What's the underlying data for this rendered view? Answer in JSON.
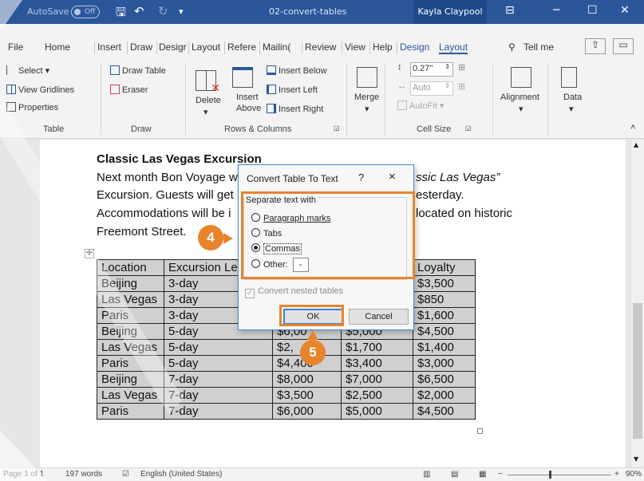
{
  "titlebar": {
    "autosave": "AutoSave",
    "autosave_state": "Off",
    "doc_title": "02-convert-tables",
    "user": "Kayla Claypool"
  },
  "tabs": [
    "File",
    "Home",
    "Insert",
    "Draw",
    "Design",
    "Layout",
    "References",
    "Mailings",
    "Review",
    "View",
    "Help",
    "Design",
    "Layout"
  ],
  "tabs_display": [
    "File",
    "Home",
    "Insert",
    "Draw",
    "Desigr",
    "Layout",
    "Refere",
    "Mailin(",
    "Review",
    "View",
    "Help",
    "Design",
    "Layout"
  ],
  "tell_me": "Tell me",
  "ribbon": {
    "select": "Select",
    "view_gridlines": "View Gridlines",
    "properties": "Properties",
    "draw_table": "Draw Table",
    "eraser": "Eraser",
    "delete": "Delete",
    "insert_above": "Insert Above",
    "insert_above_1": "Insert",
    "insert_above_2": "Above",
    "insert_below": "Insert Below",
    "insert_left": "Insert Left",
    "insert_right": "Insert Right",
    "merge": "Merge",
    "height": "0.27\"",
    "width": "Auto",
    "autofit": "AutoFit",
    "alignment": "Alignment",
    "data": "Data",
    "groups": {
      "table": "Table",
      "draw": "Draw",
      "rows_columns": "Rows & Columns",
      "cell_size": "Cell Size"
    }
  },
  "document": {
    "heading": "Classic Las Vegas Excursion",
    "line1_a": "Next month Bon Voyage w",
    "line1_b": "ssic Las Vegas”",
    "line2_a": "Excursion. Guests will get",
    "line2_b": "esterday.",
    "line3_a": "Accommodations will be i",
    "line3_b": "located on historic",
    "line4": "Freemont Street."
  },
  "table": {
    "header": [
      "Location",
      "Excursion Le",
      "",
      "",
      "Loyalty"
    ],
    "rows": [
      [
        "Beijing",
        "3-day",
        "",
        "",
        "$3,500"
      ],
      [
        "Las Vegas",
        "3-day",
        "",
        "",
        "$850"
      ],
      [
        "Paris",
        "3-day",
        "",
        "",
        "$1,600"
      ],
      [
        "Beijing",
        "5-day",
        "$6,00",
        "$5,000",
        "$4,500"
      ],
      [
        "Las Vegas",
        "5-day",
        "$2,",
        "$1,700",
        "$1,400"
      ],
      [
        "Paris",
        "5-day",
        "$4,400",
        "$3,400",
        "$3,000"
      ],
      [
        "Beijing",
        "7-day",
        "$8,000",
        "$7,000",
        "$6,500"
      ],
      [
        "Las Vegas",
        "7-day",
        "$3,500",
        "$2,500",
        "$2,000"
      ],
      [
        "Paris",
        "7-day",
        "$6,000",
        "$5,000",
        "$4,500"
      ]
    ]
  },
  "dialog": {
    "title": "Convert Table To Text",
    "help": "?",
    "close": "×",
    "group_label": "Separate text with",
    "options": [
      "Paragraph marks",
      "Tabs",
      "Commas",
      "Other:"
    ],
    "selected": "Commas",
    "other_value": "-",
    "nested_label": "Convert nested tables",
    "ok": "OK",
    "cancel": "Cancel"
  },
  "callouts": {
    "step4": "4",
    "step5": "5"
  },
  "status": {
    "page": "Page 1 of 1",
    "words": "197 words",
    "language": "English (United States)",
    "zoom": "90%"
  },
  "colors": {
    "accent": "#2b579a",
    "callout": "#e8842c",
    "dialog_border": "#4a8ad6"
  }
}
